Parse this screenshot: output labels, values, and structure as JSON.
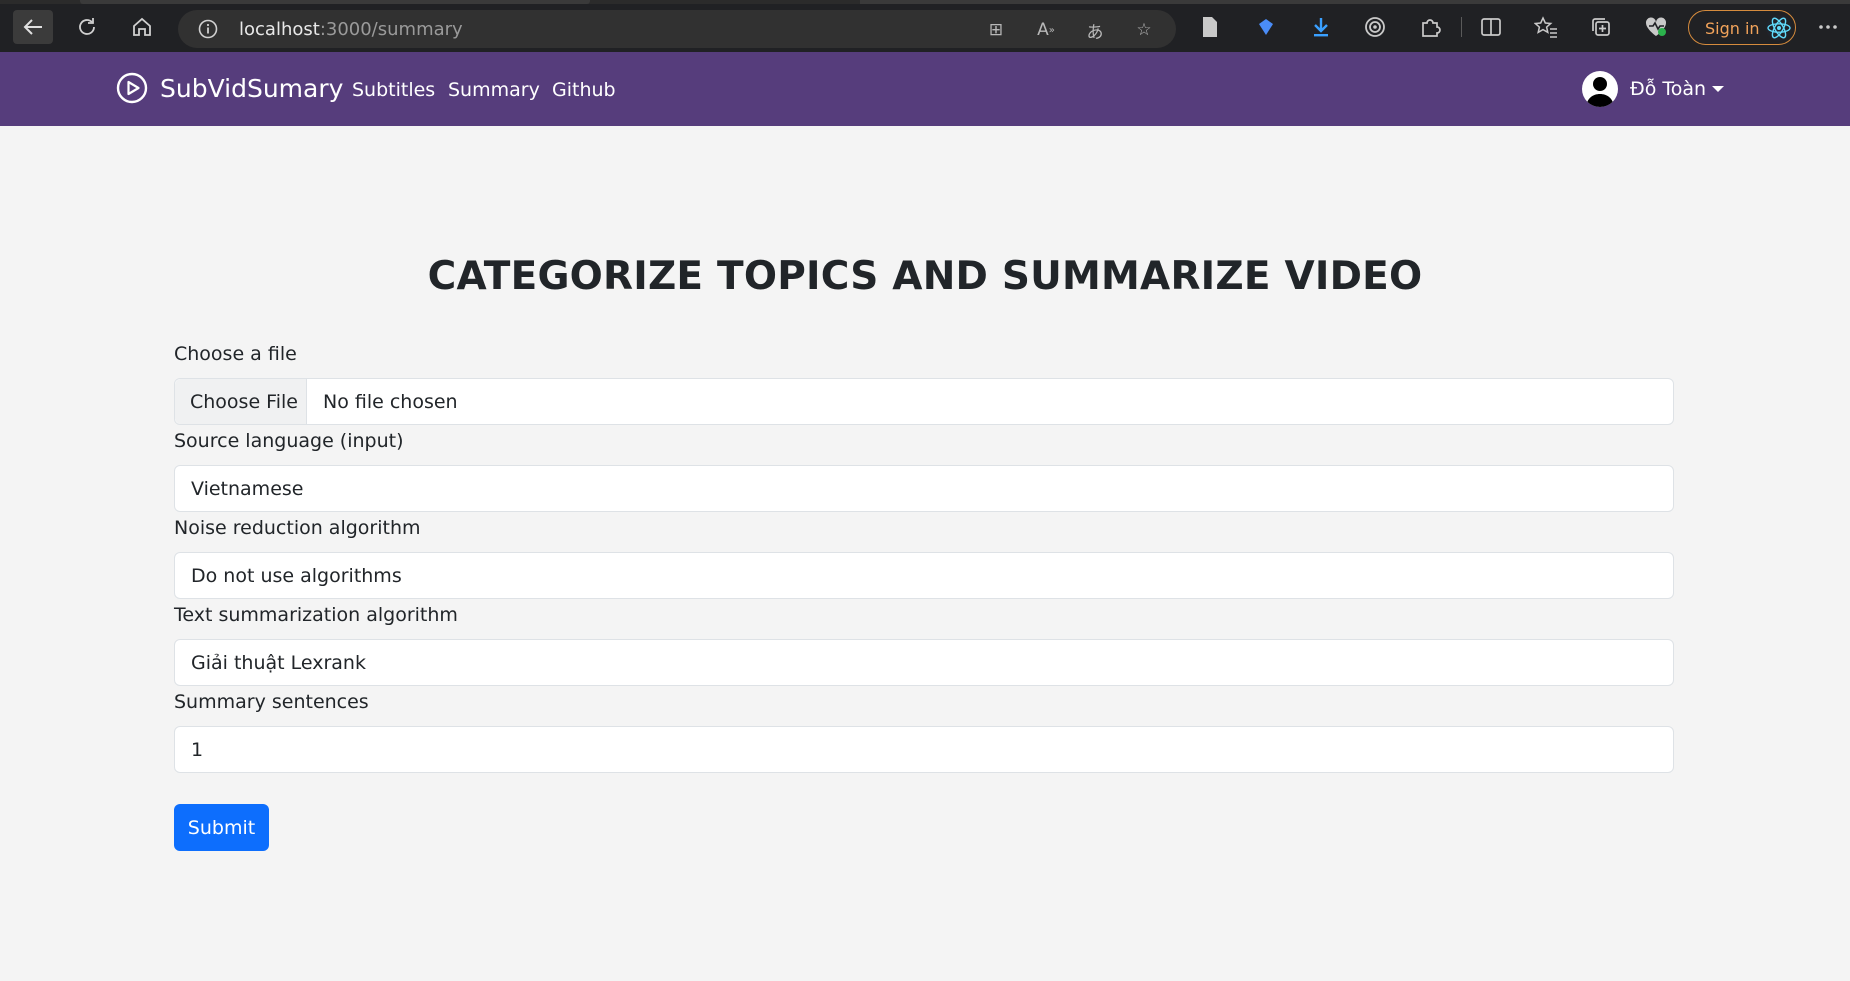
{
  "browser": {
    "url_host": "localhost",
    "url_path": ":3000/summary",
    "sign_in_label": "Sign in"
  },
  "navbar": {
    "brand": "SubVidSumary",
    "links": [
      "Subtitles",
      "Summary",
      "Github"
    ],
    "user_name": "Đỗ Toàn",
    "color": "#563d7c"
  },
  "form": {
    "title": "CATEGORIZE TOPICS AND SUMMARIZE VIDEO",
    "file": {
      "label": "Choose a file",
      "button": "Choose File",
      "status": "No file chosen"
    },
    "source_language": {
      "label": "Source language (input)",
      "value": "Vietnamese"
    },
    "noise_reduction": {
      "label": "Noise reduction algorithm",
      "value": "Do not use algorithms"
    },
    "text_summarization": {
      "label": "Text summarization algorithm",
      "value": "Giải thuật Lexrank"
    },
    "summary_sentences": {
      "label": "Summary sentences",
      "value": "1"
    },
    "submit_label": "Submit",
    "submit_color": "#0d6efd"
  }
}
